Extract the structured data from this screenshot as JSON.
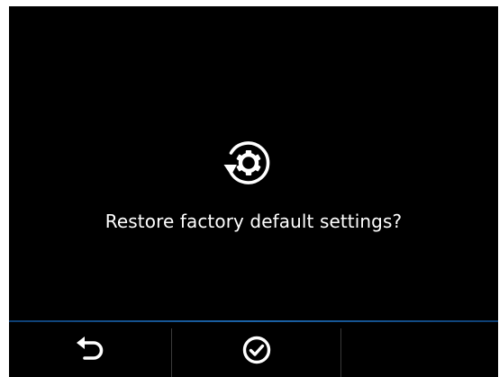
{
  "dialog": {
    "icon": "restore-settings-icon",
    "message": "Restore factory default settings?"
  },
  "footer": {
    "back_icon": "back-arrow-icon",
    "confirm_icon": "checkmark-icon"
  },
  "colors": {
    "background": "#000000",
    "text": "#ffffff",
    "footer_accent": "#1b63a8"
  }
}
